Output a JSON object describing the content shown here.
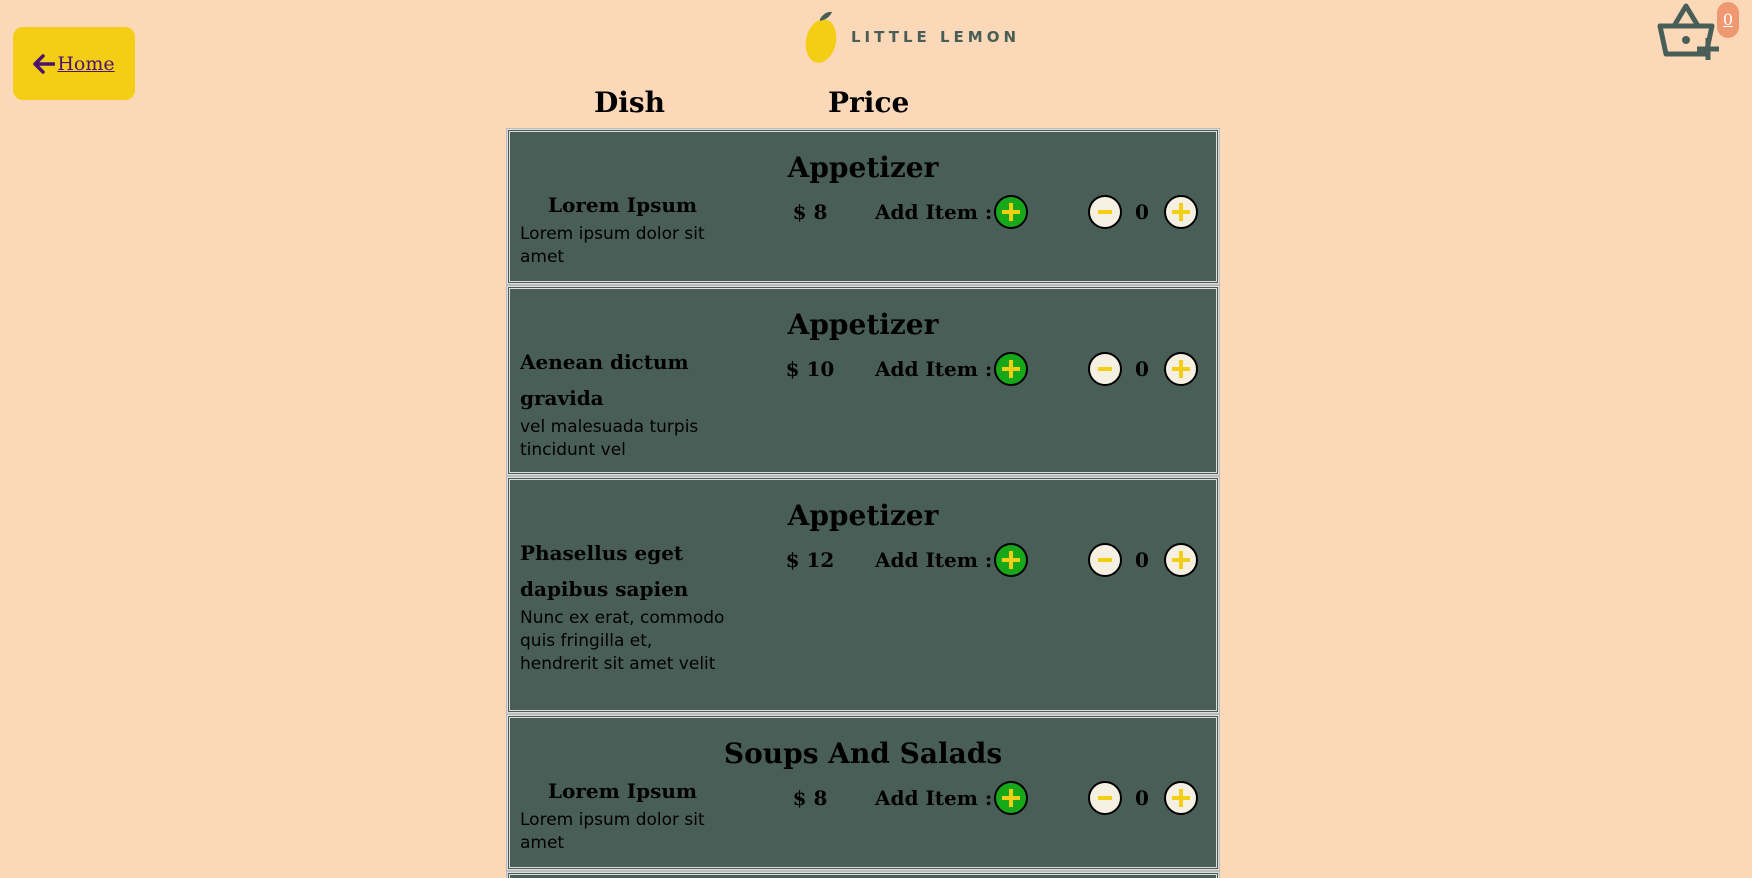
{
  "header": {
    "home_label": "Home",
    "logo_text": "LITTLE LEMON",
    "basket_count": "0"
  },
  "columns": {
    "dish": "Dish",
    "price": "Price"
  },
  "items": [
    {
      "category": "Appetizer",
      "name": "Lorem Ipsum",
      "description": "Lorem ipsum dolor sit amet",
      "price": "$ 8",
      "add_label": "Add Item :",
      "quantity": "0"
    },
    {
      "category": "Appetizer",
      "name": "Aenean dictum gravida",
      "description": "vel malesuada turpis tincidunt vel",
      "price": "$ 10",
      "add_label": "Add Item :",
      "quantity": "0"
    },
    {
      "category": "Appetizer",
      "name": "Phasellus eget dapibus sapien",
      "description": "Nunc ex erat, commodo quis fringilla et, hendrerit sit amet velit",
      "price": "$ 12",
      "add_label": "Add Item :",
      "quantity": "0"
    },
    {
      "category": "Soups And Salads",
      "name": "Lorem Ipsum",
      "description": "Lorem ipsum dolor sit amet",
      "price": "$ 8",
      "add_label": "Add Item :",
      "quantity": "0"
    }
  ],
  "colors": {
    "background": "#FBD8B8",
    "card": "#495E57",
    "accent_yellow": "#F4CE14",
    "add_green": "#17A81A",
    "badge": "#EE9972"
  },
  "icons": {
    "home": "arrow-left-icon",
    "basket": "basket-add-icon",
    "add": "plus-icon",
    "decrement": "minus-icon",
    "increment": "plus-icon"
  }
}
